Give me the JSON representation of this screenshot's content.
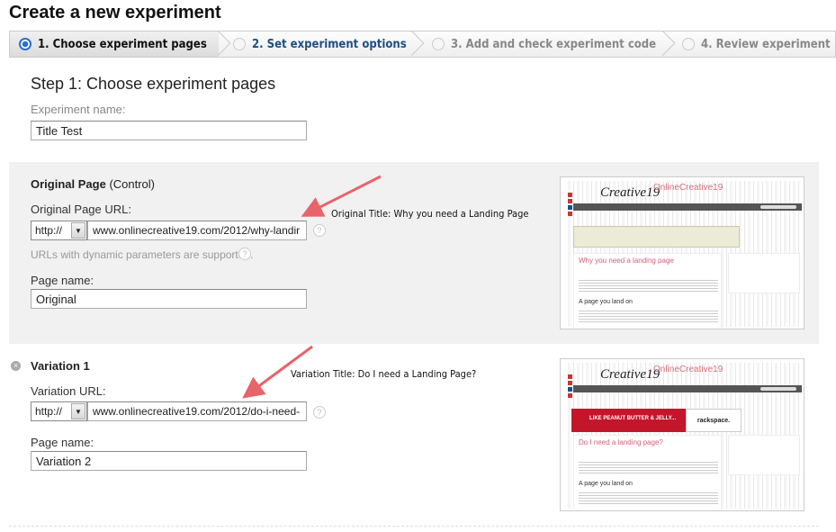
{
  "page_title": "Create a new experiment",
  "steps": [
    {
      "label": "1. Choose experiment pages",
      "state": "active"
    },
    {
      "label": "2. Set experiment options",
      "state": "next"
    },
    {
      "label": "3. Add and check experiment code",
      "state": "disabled"
    },
    {
      "label": "4. Review experiment",
      "state": "disabled"
    }
  ],
  "step_heading": "Step 1: Choose experiment pages",
  "experiment_name": {
    "label": "Experiment name:",
    "value": "Title Test"
  },
  "original": {
    "heading": "Original Page",
    "heading_suffix": "(Control)",
    "url_label": "Original Page URL:",
    "protocol": "http://",
    "url": "www.onlinecreative19.com/2012/why-landir",
    "hint": "URLs with dynamic parameters are supported.",
    "page_name_label": "Page name:",
    "page_name": "Original",
    "annotation": "Original Title: Why you need a Landing Page",
    "preview": {
      "brand": "OnlineCreative19",
      "logo": "Creative19",
      "heading": "Why you need a landing page",
      "subheading": "A page you land on"
    }
  },
  "variation": {
    "heading": "Variation 1",
    "url_label": "Variation URL:",
    "protocol": "http://",
    "url": "www.onlinecreative19.com/2012/do-i-need-",
    "page_name_label": "Page name:",
    "page_name": "Variation 2",
    "annotation": "Variation Title: Do I  need a Landing Page?",
    "preview": {
      "brand": "OnlineCreative19",
      "logo": "Creative19",
      "heading": "Do I need a landing page?",
      "subheading": "A page you land on",
      "ad_text": "LIKE PEANUT BUTTER & JELLY...",
      "ad_brand": "rackspace."
    }
  },
  "help_glyph": "?",
  "colors": {
    "accent": "#2a6dd3",
    "arrow": "#e8636a",
    "panel": "#f1f1f1"
  }
}
